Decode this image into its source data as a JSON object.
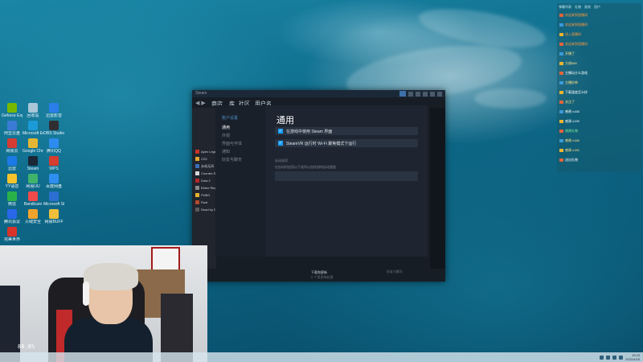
{
  "desktop": {
    "icons": [
      {
        "label": "Geforce Experience",
        "color": "#76b900"
      },
      {
        "label": "回收站",
        "color": "#a9c6d9"
      },
      {
        "label": "迅雷影音",
        "color": "#2b7de9"
      },
      {
        "label": "阿里云盘",
        "color": "#3a7bd5"
      },
      {
        "label": "Microsoft Edge",
        "color": "#1b9ad8"
      },
      {
        "label": "OBS Studio",
        "color": "#302e31"
      },
      {
        "label": "网易云",
        "color": "#d43c33"
      },
      {
        "label": "Google Chrome",
        "color": "#e5b633"
      },
      {
        "label": "腾讯QQ",
        "color": "#2d8cf0"
      },
      {
        "label": "迅雷",
        "color": "#1c7ae6"
      },
      {
        "label": "Steam",
        "color": "#1b2838"
      },
      {
        "label": "WPS",
        "color": "#d63c2f"
      },
      {
        "label": "YY语音",
        "color": "#f5c32c"
      },
      {
        "label": "网易UU",
        "color": "#3fb36b"
      },
      {
        "label": "百度网盘",
        "color": "#2f8ff0"
      },
      {
        "label": "微信",
        "color": "#2ab24a"
      },
      {
        "label": "Bandicam",
        "color": "#f04a4a"
      },
      {
        "label": "Microsoft Store",
        "color": "#2a6fd1"
      },
      {
        "label": "腾讯会议",
        "color": "#2767e8"
      },
      {
        "label": "火绒安全",
        "color": "#f2a32c"
      },
      {
        "label": "网易BUFF",
        "color": "#f0be3a"
      },
      {
        "label": "完美世界",
        "color": "#d8332b"
      }
    ]
  },
  "steam": {
    "title": "Steam",
    "nav": {
      "store": "商店",
      "library": "库",
      "community": "社区",
      "profile": "用户名"
    },
    "library_items": [
      "Apex Legends",
      "CS2",
      "永劫无间",
      "Counter-Strike",
      "Dota 2",
      "Elden Ring",
      "PUBG",
      "Rust",
      "Dead by Daylight"
    ],
    "footer": {
      "downloads": "下载和更新",
      "downloads_sub": "0 个项目待处理",
      "friends": "好友与聊天"
    }
  },
  "settings": {
    "sidebar_header": "账户设置",
    "nav": [
      {
        "label": "通用",
        "active": true
      },
      {
        "label": "外观"
      },
      {
        "label": "界面与字体"
      },
      {
        "label": "通知"
      },
      {
        "label": "好友与聊天"
      }
    ],
    "heading": "通用",
    "checkboxes": [
      {
        "label": "在游戏中使用 Steam 界面",
        "checked": true
      },
      {
        "label": "SteamVR 运行时 Wi-Fi 聚焦模式下运行",
        "checked": true
      }
    ],
    "section_label": "启动选项",
    "section_desc": "在启动时启用以下选项以加快游戏启动速度"
  },
  "chat": {
    "tabs": [
      "弹幕列表",
      "礼物",
      "贵宾",
      "用户"
    ],
    "lines": [
      {
        "text": "欢迎来到直播间",
        "color": "#ff9a3c"
      },
      {
        "text": "欢迎来到直播间",
        "color": "#ff9a3c"
      },
      {
        "text": "进入直播间",
        "color": "#ff9a3c"
      },
      {
        "text": "欢迎来到直播间",
        "color": "#ff9a3c"
      },
      {
        "text": "开播了",
        "color": "#ffe48a"
      },
      {
        "text": "大佬666",
        "color": "#ffe48a"
      },
      {
        "text": "主播玩什么游戏",
        "color": "#ffffff"
      },
      {
        "text": "主播好帅",
        "color": "#ffe48a"
      },
      {
        "text": "下载速度怎么样",
        "color": "#ffffff"
      },
      {
        "text": "关注了",
        "color": "#ffe48a"
      },
      {
        "text": "感谢 x168",
        "color": "#ffffff"
      },
      {
        "text": "感谢 x199",
        "color": "#ffffff"
      },
      {
        "text": "谢谢礼物",
        "color": "#7ef09b"
      },
      {
        "text": "感谢 x168",
        "color": "#ffe48a"
      },
      {
        "text": "感谢 x150",
        "color": "#ffe48a"
      },
      {
        "text": "送出礼物",
        "color": "#ffffff"
      }
    ]
  },
  "webcam": {
    "counter": "88.8%"
  },
  "taskbar": {
    "time": "19:23",
    "date": "2022/4/25"
  }
}
